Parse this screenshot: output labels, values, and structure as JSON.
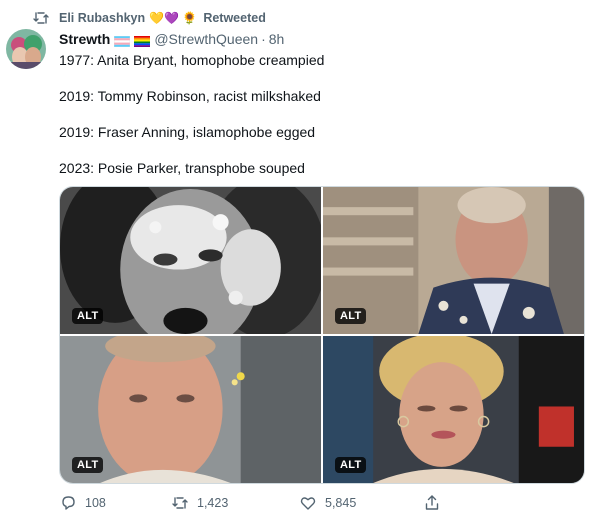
{
  "retweet": {
    "user": "Eli Rubashkyn",
    "emojis": "💛💜 🌻",
    "suffix": "Retweeted"
  },
  "author": {
    "display_name": "Strewth",
    "handle": "@StrewthQueen",
    "separator": "·",
    "time": "8h"
  },
  "tweet": {
    "lines": [
      "1977: Anita Bryant, homophobe creampied",
      "2019: Tommy Robinson, racist milkshaked",
      "2019: Fraser Anning, islamophobe egged",
      "2023: Posie Parker, transphobe souped"
    ]
  },
  "media": [
    {
      "alt_label": "ALT"
    },
    {
      "alt_label": "ALT"
    },
    {
      "alt_label": "ALT"
    },
    {
      "alt_label": "ALT"
    }
  ],
  "actions": {
    "reply_count": "108",
    "retweet_count": "1,423",
    "like_count": "5,845"
  },
  "icons": {
    "retweet": "retweet-icon",
    "reply": "reply-icon",
    "like": "heart-icon",
    "share": "share-icon"
  },
  "colors": {
    "text": "#0f1419",
    "secondary": "#536471",
    "border": "#cfd9de"
  }
}
